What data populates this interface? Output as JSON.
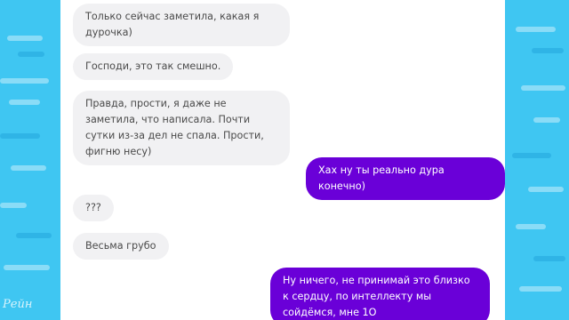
{
  "conversation": {
    "messages": [
      {
        "direction": "incoming",
        "text": "Только сейчас заметила, какая я дурочка)"
      },
      {
        "direction": "incoming",
        "text": "Господи, это так смешно."
      },
      {
        "direction": "incoming",
        "text": "Правда, прости, я даже не заметила, что написала. Почти сутки из-за дел не спала. Прости, фигню несу)"
      },
      {
        "direction": "outgoing",
        "text": "Хах ну ты реально дура конечно)"
      },
      {
        "direction": "incoming",
        "text": "???"
      },
      {
        "direction": "incoming",
        "text": "Весьма грубо"
      },
      {
        "direction": "outgoing",
        "text": "Ну ничего, не принимай это близко к сердцу, по интеллекту мы сойдёмся, мне 1О"
      }
    ]
  },
  "colors": {
    "background": "#3fc6f2",
    "incoming_bubble": "#f1f1f3",
    "outgoing_bubble": "#6a00d8"
  },
  "watermark": {
    "text": "Рейн"
  }
}
